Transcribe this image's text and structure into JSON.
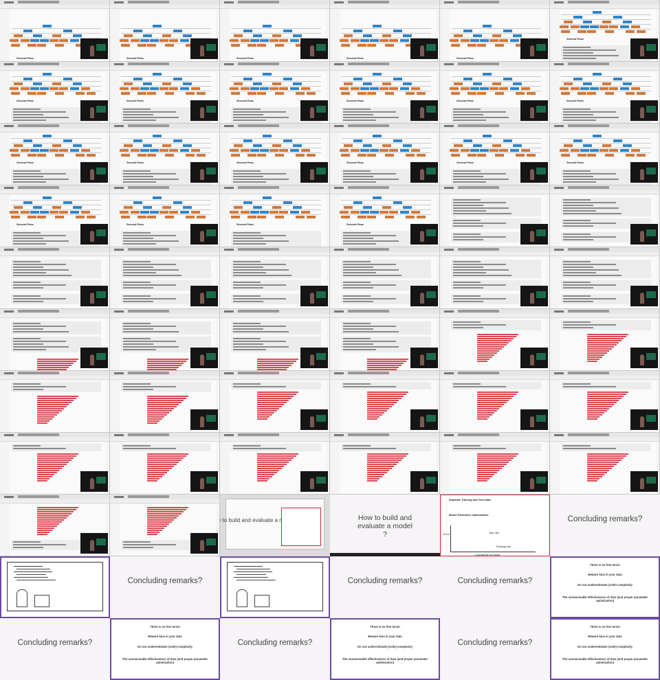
{
  "labels": {
    "second_pass": "Second Pass",
    "how_to_build": "How to build and evaluate a model ?",
    "concluding": "Concluding remarks?"
  },
  "remarks": [
    "There is no free lunch",
    "Beware bias in your data",
    "Do not underestimate (code) complexity",
    "The unreasonable effectiveness of data (and proper parameter optimization)"
  ],
  "slide_box": {
    "title": "Separate Training and Test Data",
    "subtitle": "Model Parameter Optimization",
    "axis_x": "Complexity of model",
    "axis_y": "Error",
    "curve_training": "Training risk",
    "curve_test": "Test risk"
  },
  "colors": {
    "orange_box": "#d0783a",
    "blue_box": "#2f84c8",
    "red_bar": "#d9474f",
    "slide_border": "#6a4aa0"
  }
}
